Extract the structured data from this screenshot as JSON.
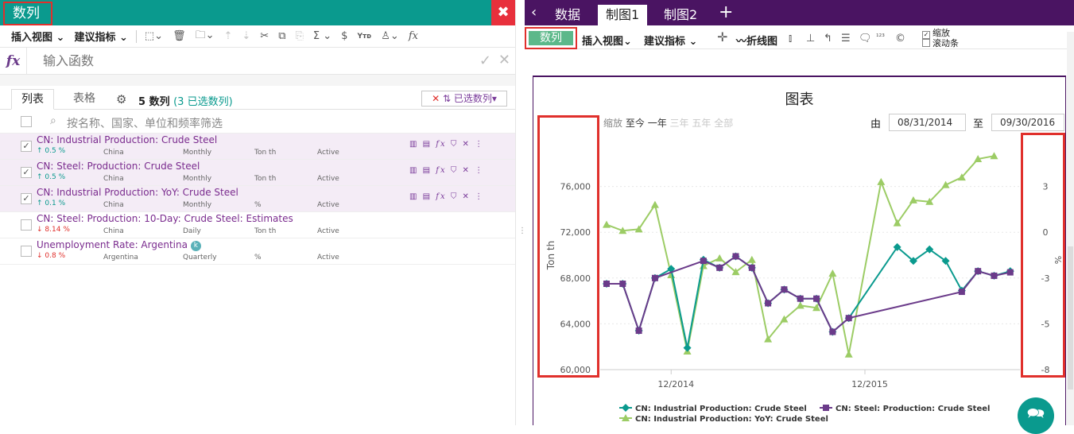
{
  "left_panel": {
    "title": "数列",
    "close_glyph": "✖",
    "toolbar": {
      "insert_view": "插入视图",
      "suggest_indicator": "建议指标",
      "icons": [
        "select-icon",
        "trash-icon",
        "folder-icon",
        "move-up-icon",
        "move-down-icon",
        "cut-icon",
        "copy-icon",
        "paste-icon",
        "sum-icon",
        "currency-icon",
        "ytd-icon",
        "brush-icon",
        "function-icon"
      ]
    },
    "formula": {
      "fx_label": "fx",
      "placeholder": "输入函数"
    },
    "tabs": {
      "list": "列表",
      "table": "表格"
    },
    "series_count_label": "5 数列",
    "selected_count_label": "(3 已选数列)",
    "selected_series_button": "已选数列",
    "filter_placeholder": "按名称、国家、单位和频率筛选",
    "rows": [
      {
        "name": "CN: Industrial Production: Crude Steel",
        "change": "0.5 %",
        "direction": "up",
        "region": "China",
        "frequency": "Monthly",
        "unit": "Ton th",
        "status": "Active",
        "checked": true
      },
      {
        "name": "CN: Steel: Production: Crude Steel",
        "change": "0.5 %",
        "direction": "up",
        "region": "China",
        "frequency": "Monthly",
        "unit": "Ton th",
        "status": "Active",
        "checked": true
      },
      {
        "name": "CN: Industrial Production: YoY: Crude Steel",
        "change": "0.1 %",
        "direction": "up",
        "region": "China",
        "frequency": "Monthly",
        "unit": "%",
        "status": "Active",
        "checked": true
      },
      {
        "name": "CN: Steel: Production: 10-Day: Crude Steel: Estimates",
        "change": "8.14 %",
        "direction": "down",
        "region": "China",
        "frequency": "Daily",
        "unit": "Ton th",
        "status": "Active",
        "checked": false
      },
      {
        "name": "Unemployment Rate: Argentina",
        "badge": "k",
        "change": "0.8 %",
        "direction": "down",
        "region": "Argentina",
        "frequency": "Quarterly",
        "unit": "%",
        "status": "Active",
        "checked": false
      }
    ]
  },
  "right_panel": {
    "tabs": [
      "数据",
      "制图1",
      "制图2"
    ],
    "active_tab": "制图1",
    "toolbar": {
      "series_button": "数列",
      "insert_view": "插入视图",
      "suggest_indicator": "建议指标",
      "line_chart": "折线图",
      "zoom_option": "缩放",
      "scrollbar_option": "滚动条"
    },
    "chart_header": {
      "range_buttons": [
        "缩放",
        "至今",
        "一年",
        "三年",
        "五年",
        "全部"
      ],
      "from_label": "由",
      "from_date": "08/31/2014",
      "to_label": "至",
      "to_date": "09/30/2016"
    }
  },
  "colors": {
    "teal": "#0a9a8e",
    "purple": "#6b3b8a",
    "green": "#9ccc65",
    "dark_purple": "#4a1462",
    "red": "#e0302c"
  },
  "chart_data": {
    "type": "line",
    "title": "图表",
    "xlabel": "",
    "ylabel": "Ton th",
    "y2label": "%",
    "x_tick_labels": [
      "12/2014",
      "12/2015"
    ],
    "x_tick_months": [
      4,
      16
    ],
    "ylim": [
      60000,
      80000
    ],
    "y_ticks": [
      60000,
      64000,
      68000,
      72000,
      76000
    ],
    "y_tick_labels": [
      "60,000",
      "64,000",
      "68,000",
      "72,000",
      "76,000"
    ],
    "y2lim": [
      -8,
      5
    ],
    "y2_ticks": [
      -8,
      -5,
      -3,
      0,
      3
    ],
    "y2_tick_labels": [
      "-8",
      "-5",
      "-3",
      "0",
      "3"
    ],
    "legend_position": "bottom",
    "series": [
      {
        "name": "CN: Industrial Production: Crude Steel",
        "axis": "left",
        "color": "#0a9a8e",
        "marker": "diamond",
        "points": [
          [
            0,
            67500
          ],
          [
            1,
            67500
          ],
          [
            2,
            63400
          ],
          [
            3,
            68000
          ],
          [
            4,
            68800
          ],
          [
            5,
            61900
          ],
          [
            6,
            69600
          ],
          [
            7,
            68900
          ],
          [
            8,
            69900
          ],
          [
            9,
            68900
          ],
          [
            10,
            65800
          ],
          [
            11,
            67000
          ],
          [
            12,
            66200
          ],
          [
            13,
            66200
          ],
          [
            14,
            63300
          ],
          [
            15,
            64500
          ],
          [
            18,
            70700
          ],
          [
            19,
            69500
          ],
          [
            20,
            70500
          ],
          [
            21,
            69500
          ],
          [
            22,
            66900
          ],
          [
            23,
            68600
          ],
          [
            24,
            68200
          ],
          [
            25,
            68600
          ]
        ]
      },
      {
        "name": "CN: Steel: Production: Crude Steel",
        "axis": "left",
        "color": "#6b3b8a",
        "marker": "square",
        "points": [
          [
            0,
            67500
          ],
          [
            1,
            67500
          ],
          [
            2,
            63400
          ],
          [
            3,
            68000
          ],
          [
            6,
            69500
          ],
          [
            7,
            68900
          ],
          [
            8,
            69900
          ],
          [
            9,
            68900
          ],
          [
            10,
            65800
          ],
          [
            11,
            67000
          ],
          [
            12,
            66200
          ],
          [
            13,
            66200
          ],
          [
            14,
            63300
          ],
          [
            15,
            64500
          ],
          [
            22,
            66800
          ],
          [
            23,
            68600
          ],
          [
            24,
            68200
          ],
          [
            25,
            68500
          ]
        ]
      },
      {
        "name": "CN: Industrial Production: YoY: Crude Steel",
        "axis": "right",
        "color": "#9ccc65",
        "marker": "triangle",
        "points": [
          [
            0,
            0.5
          ],
          [
            1,
            0.1
          ],
          [
            2,
            0.2
          ],
          [
            3,
            1.8
          ],
          [
            4,
            -2.8
          ],
          [
            5,
            -6.8
          ],
          [
            6,
            -2.2
          ],
          [
            7,
            -1.7
          ],
          [
            8,
            -2.6
          ],
          [
            9,
            -1.8
          ],
          [
            10,
            -6.0
          ],
          [
            11,
            -4.8
          ],
          [
            12,
            -4.2
          ],
          [
            13,
            -4.3
          ],
          [
            14,
            -2.7
          ],
          [
            15,
            -7.0
          ],
          [
            17,
            3.3
          ],
          [
            18,
            0.6
          ],
          [
            19,
            2.1
          ],
          [
            20,
            2.0
          ],
          [
            21,
            3.1
          ],
          [
            22,
            3.6
          ],
          [
            23,
            4.8
          ],
          [
            24,
            5.0
          ]
        ]
      }
    ]
  }
}
